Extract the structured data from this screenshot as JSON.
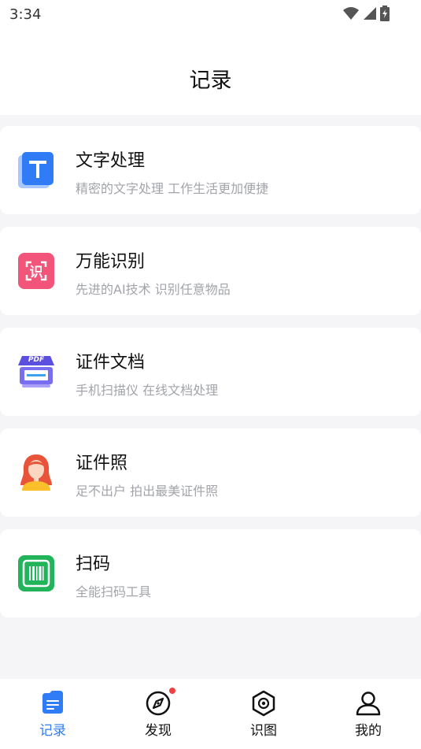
{
  "status_bar": {
    "time": "3:34",
    "icons": [
      "wifi-icon",
      "cellular-signal-icon",
      "battery-charging-icon"
    ]
  },
  "header": {
    "title": "记录"
  },
  "cards": [
    {
      "title": "文字处理",
      "subtitle": "精密的文字处理  工作生活更加便捷",
      "icon": "text-t-icon",
      "color": "#2f7cf6"
    },
    {
      "title": "万能识别",
      "subtitle": "先进的AI技术 识别任意物品",
      "icon": "recognize-icon",
      "color": "#f2547a",
      "icon_text": "识"
    },
    {
      "title": "证件文档",
      "subtitle": "手机扫描仪 在线文档处理",
      "icon": "pdf-scanner-icon",
      "color": "#5b4fe0",
      "icon_text": "PDF"
    },
    {
      "title": "证件照",
      "subtitle": "足不出户  拍出最美证件照",
      "icon": "id-photo-icon",
      "color": "#e8533a"
    },
    {
      "title": "扫码",
      "subtitle": "全能扫码工具",
      "icon": "barcode-icon",
      "color": "#22b45a"
    }
  ],
  "bottom_nav": {
    "active_color": "#2f7cf6",
    "items": [
      {
        "label": "记录",
        "icon": "record-icon",
        "active": true
      },
      {
        "label": "发现",
        "icon": "compass-icon",
        "active": false,
        "badge": true
      },
      {
        "label": "识图",
        "icon": "image-recognition-icon",
        "active": false
      },
      {
        "label": "我的",
        "icon": "user-icon",
        "active": false
      }
    ]
  }
}
